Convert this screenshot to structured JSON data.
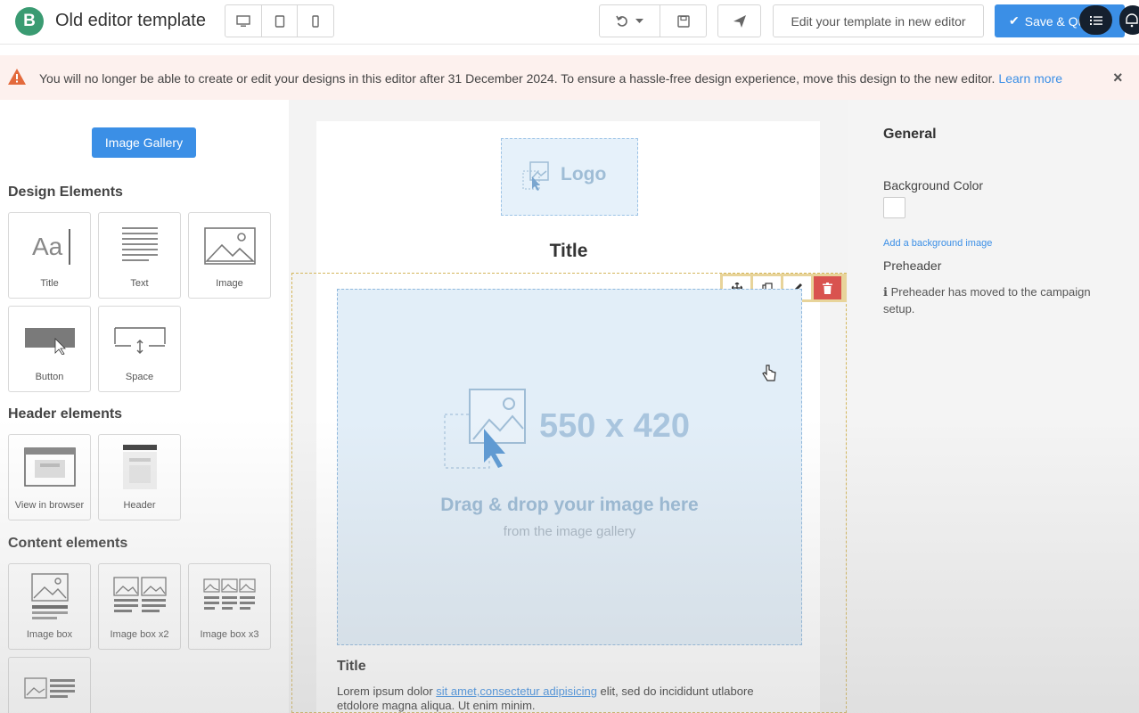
{
  "app": {
    "logo_letter": "B",
    "title": "Old editor template"
  },
  "toolbar": {
    "edit_new_label": "Edit your template in new editor",
    "save_quit_label": "Save & Qu"
  },
  "banner": {
    "text": "You will no longer be able to create or edit your designs in this editor after 31 December 2024. To ensure a hassle-free design experience, move this design to the new editor.",
    "link": "Learn more",
    "close": "×"
  },
  "sidebar": {
    "gallery_button": "Image Gallery",
    "design_title": "Design Elements",
    "design_items": [
      "Title",
      "Text",
      "Image",
      "Button",
      "Space"
    ],
    "title_glyph": "Aa",
    "header_title": "Header elements",
    "header_items": [
      "View in browser",
      "Header"
    ],
    "content_title": "Content elements",
    "content_items": [
      "Image box",
      "Image box x2",
      "Image box x3"
    ]
  },
  "canvas": {
    "logo_placeholder": "Logo",
    "email_title": "Title",
    "image_dimensions": "550 x 420",
    "drag_text": "Drag & drop your image here",
    "drag_sub": "from the image gallery",
    "section_title": "Title",
    "lorem_start": "Lorem ipsum dolor ",
    "lorem_link": "sit amet,consectetur adipisicing",
    "lorem_end": " elit, sed do incididunt utlabore etdolore magna aliqua. Ut enim minim."
  },
  "panel": {
    "general": "General",
    "bg_color_label": "Background Color",
    "bg_color": "#ffffff",
    "add_bg_image": "Add a background image",
    "preheader_label": "Preheader",
    "preheader_note": "Preheader has moved to the campaign setup."
  },
  "colors": {
    "primary": "#3b8fe6",
    "brand": "#3a9b72",
    "danger": "#d9534f",
    "warning_bg": "#fdf1ee"
  }
}
